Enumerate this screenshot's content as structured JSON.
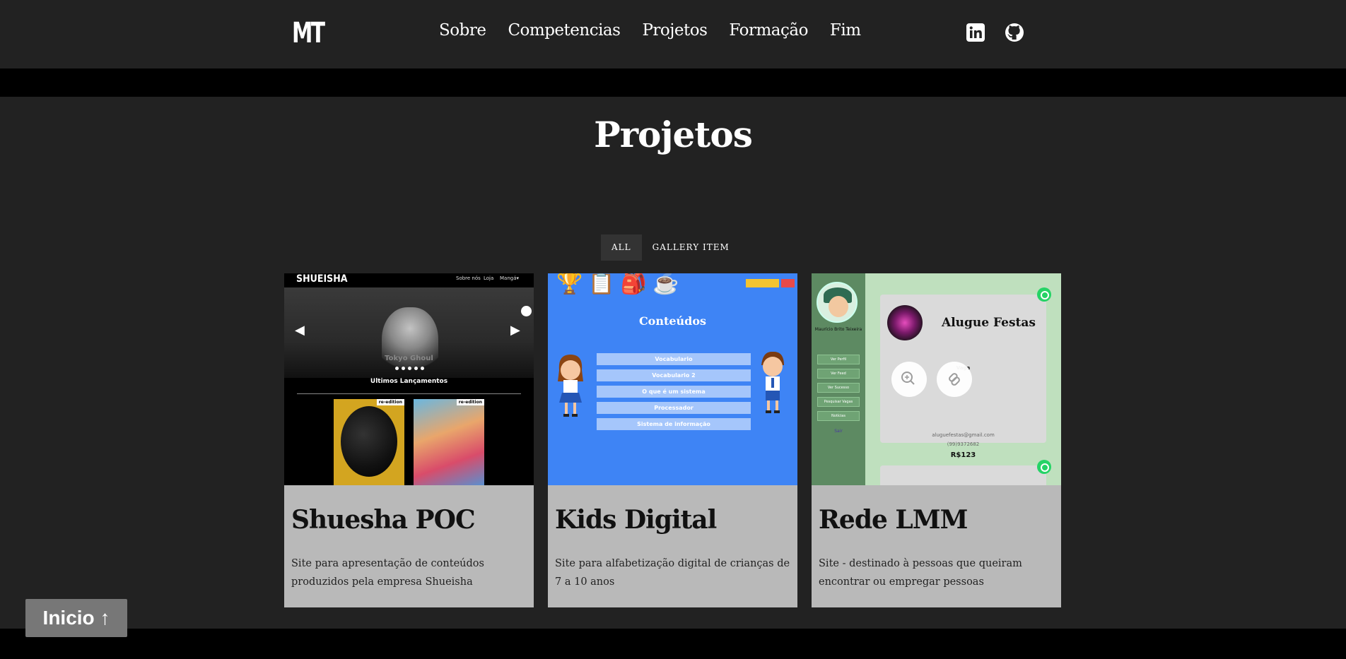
{
  "nav": {
    "logo": "MT",
    "links": [
      "Sobre",
      "Competencias",
      "Projetos",
      "Formação",
      "Fim"
    ],
    "social": [
      {
        "icon": "linkedin-icon"
      },
      {
        "icon": "github-icon"
      }
    ]
  },
  "projects": {
    "title": "Projetos",
    "filters": [
      {
        "label": "ALL",
        "active": true
      },
      {
        "label": "GALLERY ITEM",
        "active": false
      }
    ],
    "cards": [
      {
        "title": "Shuesha POC",
        "description": "Site para apresentação de conteúdos produzidos pela empresa Shueisha",
        "thumb": {
          "brand": "SHUEISHA",
          "nav": [
            "Sobre nós",
            "Loja",
            "Mangá▾"
          ],
          "caption": "Tokyo Ghoul",
          "section": "Ultimos Lançamentos",
          "tag": "re-edition"
        }
      },
      {
        "title": "Kids Digital",
        "description": "Site para alfabetização digital de crianças de 7 a 10 anos",
        "thumb": {
          "heading": "Conteúdos",
          "items": [
            "Vocabulario",
            "Vocabulario 2",
            "O que é um sistema",
            "Processador",
            "Sistema de informação"
          ]
        }
      },
      {
        "title": "Rede LMM",
        "description": "Site - destinado à pessoas que queiram encontrar ou empregar pessoas",
        "thumb": {
          "name": "Maurício Brito Teixeira",
          "menu": [
            "Ver Perfil",
            "Ver Feed",
            "Ver Sucesso",
            "Pesquisar Vagas",
            "Notícias"
          ],
          "logout": "Sair",
          "heading": "Alugue Festas",
          "label": "Vaga",
          "email": "aluguefestas@gmail.com",
          "phone": "(99)9372682",
          "price": "R$123"
        }
      }
    ]
  },
  "back_to_top": "Inicio ↑"
}
